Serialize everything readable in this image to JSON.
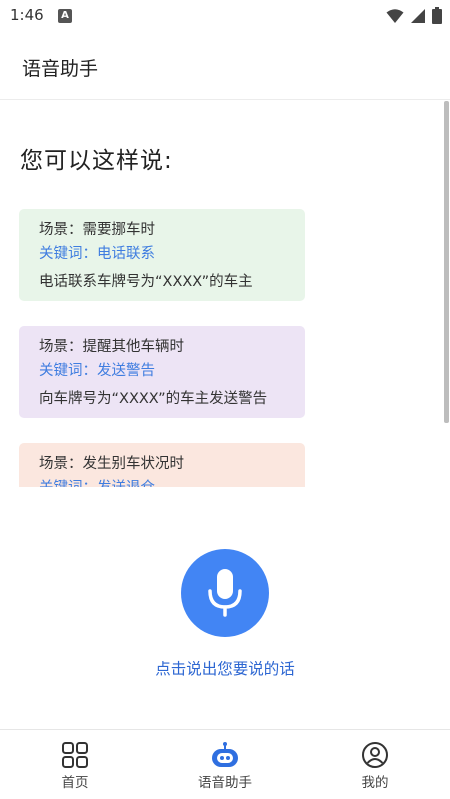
{
  "status_bar": {
    "time": "1:46",
    "app_icon_letter": "A"
  },
  "header": {
    "title": "语音助手"
  },
  "section_title": "您可以这样说:",
  "cards": [
    {
      "scene": "场景：需要挪车时",
      "keyword": "关键词：电话联系",
      "example": "电话联系车牌号为“XXXX”的车主",
      "bg": "#e8f5e9"
    },
    {
      "scene": "场景：提醒其他车辆时",
      "keyword": "关键词：发送警告",
      "example": "向车牌号为“XXXX”的车主发送警告",
      "bg": "#ede4f5"
    },
    {
      "scene": "场景：发生别车状况时",
      "keyword": "关键词：发送退仓",
      "example": "",
      "bg": "#fbe7df"
    }
  ],
  "mic": {
    "icon": "microphone-icon",
    "hint": "点击说出您要说的话",
    "color": "#4285f4"
  },
  "bottom_nav": [
    {
      "label": "首页",
      "icon": "grid-icon"
    },
    {
      "label": "语音助手",
      "icon": "robot-icon"
    },
    {
      "label": "我的",
      "icon": "profile-icon"
    }
  ]
}
